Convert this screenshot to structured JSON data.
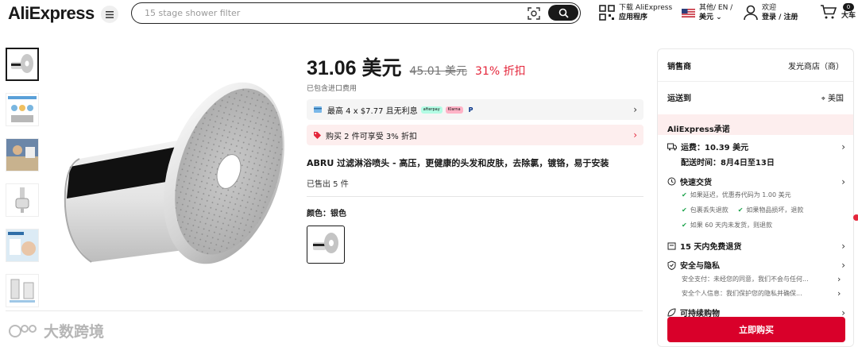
{
  "header": {
    "logo": "AliExpress",
    "search_placeholder": "15 stage shower filter",
    "app_line1": "下载 AliExpress",
    "app_line2": "应用程序",
    "lang_line1": "其他/ EN /",
    "lang_line2": "美元",
    "user_line1": "欢迎",
    "user_line2": "登录 / 注册",
    "cart_count": "0",
    "cart_label": "大车"
  },
  "product": {
    "price": "31.06 美元",
    "original_price": "45.01 美元",
    "discount": "31% 折扣",
    "tax_note": "已包含进口费用",
    "installment": "最高 4 x $7.77 且无利息",
    "pay_chips": [
      "afterpay",
      "Klarna",
      "P"
    ],
    "promo": "购买 2 件可享受 3% 折扣",
    "title": "ABRU 过滤淋浴喷头 - 高压，更健康的头发和皮肤，去除氯，镀铬，易于安装",
    "sold": "已售出 5 件",
    "color_label": "颜色：银色"
  },
  "panel": {
    "seller_label": "销售商",
    "seller_value": "发光商店（商）",
    "ship_label": "运送到",
    "ship_value": "美国",
    "promise_title": "AliExpress承诺",
    "shipping_fee": "运费：10.39 美元",
    "delivery": "配送时间：8月4日至13日",
    "fast_delivery": "快速交货",
    "fast_subs": [
      "如果延迟，优惠券代码为 1.00 美元",
      "包裹丢失退款",
      "如果物品损坏，退款",
      "如果 60 天内未发货，则退款"
    ],
    "free_returns": "15 天内免费退货",
    "security": "安全与隐私",
    "security_subs": [
      "安全支付：未经您的同意，我们不会与任何...",
      "安全个人信息：我们保护您的隐私并确保..."
    ],
    "sustainable": "可持续购物",
    "buy_now": "立即购买"
  },
  "watermark": "大数跨境",
  "colors": {
    "accent": "#e4263b",
    "buy": "#d9002a",
    "promo_bg": "#fdeeee"
  }
}
